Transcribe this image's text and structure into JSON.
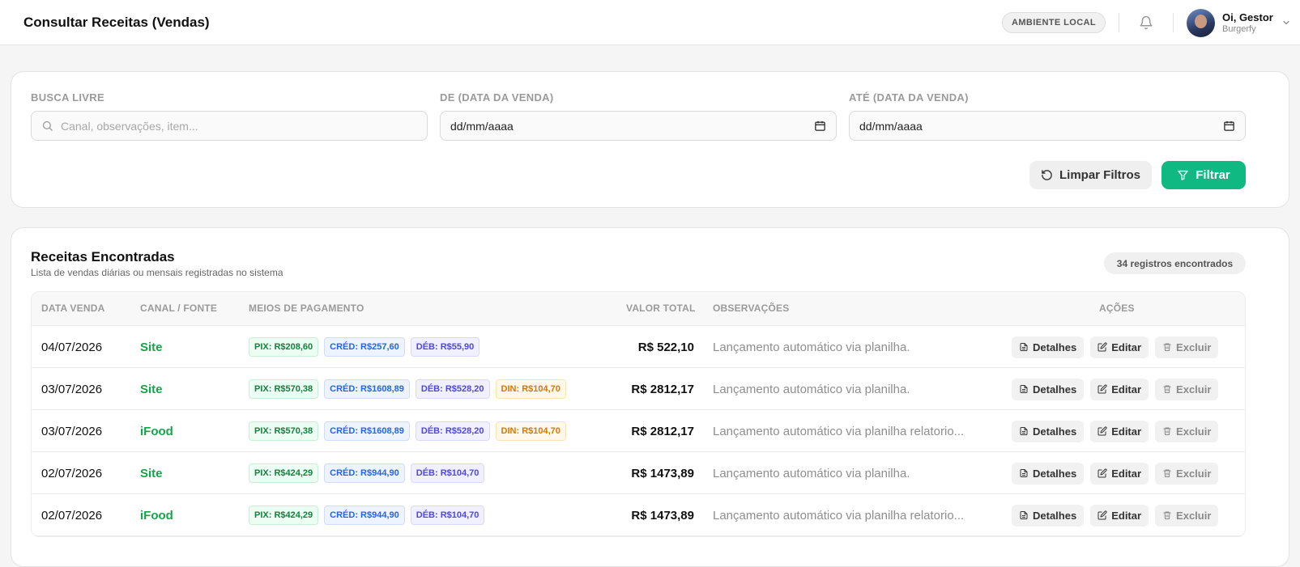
{
  "header": {
    "title": "Consultar Receitas (Vendas)",
    "env_badge": "AMBIENTE LOCAL",
    "user_name": "Oi, Gestor",
    "user_company": "Burgerfy"
  },
  "filters": {
    "search_label": "BUSCA LIVRE",
    "search_placeholder": "Canal, observações, item...",
    "from_label": "DE (DATA DA VENDA)",
    "from_value": "dd/mm/aaaa",
    "to_label": "ATÉ (DATA DA VENDA)",
    "to_value": "dd/mm/aaaa",
    "clear_label": "Limpar Filtros",
    "filter_label": "Filtrar"
  },
  "results": {
    "title": "Receitas Encontradas",
    "subtitle": "Lista de vendas diárias ou mensais registradas no sistema",
    "count": "34 registros encontrados",
    "columns": [
      "DATA VENDA",
      "CANAL / FONTE",
      "MEIOS DE PAGAMENTO",
      "VALOR TOTAL",
      "OBSERVAÇÕES",
      "AÇÕES"
    ],
    "actions": {
      "details": "Detalhes",
      "edit": "Editar",
      "delete": "Excluir"
    },
    "rows": [
      {
        "date": "04/07/2026",
        "channel": "Site",
        "payments": [
          {
            "type": "pix",
            "label": "PIX: R$208,60"
          },
          {
            "type": "cred",
            "label": "CRÉD: R$257,60"
          },
          {
            "type": "deb",
            "label": "DÉB: R$55,90"
          }
        ],
        "total": "R$ 522,10",
        "obs": "Lançamento automático via planilha."
      },
      {
        "date": "03/07/2026",
        "channel": "Site",
        "payments": [
          {
            "type": "pix",
            "label": "PIX: R$570,38"
          },
          {
            "type": "cred",
            "label": "CRÉD: R$1608,89"
          },
          {
            "type": "deb",
            "label": "DÉB: R$528,20"
          },
          {
            "type": "din",
            "label": "DIN: R$104,70"
          }
        ],
        "total": "R$ 2812,17",
        "obs": "Lançamento automático via planilha."
      },
      {
        "date": "03/07/2026",
        "channel": "iFood",
        "payments": [
          {
            "type": "pix",
            "label": "PIX: R$570,38"
          },
          {
            "type": "cred",
            "label": "CRÉD: R$1608,89"
          },
          {
            "type": "deb",
            "label": "DÉB: R$528,20"
          },
          {
            "type": "din",
            "label": "DIN: R$104,70"
          }
        ],
        "total": "R$ 2812,17",
        "obs": "Lançamento automático via planilha relatorio..."
      },
      {
        "date": "02/07/2026",
        "channel": "Site",
        "payments": [
          {
            "type": "pix",
            "label": "PIX: R$424,29"
          },
          {
            "type": "cred",
            "label": "CRÉD: R$944,90"
          },
          {
            "type": "deb",
            "label": "DÉB: R$104,70"
          }
        ],
        "total": "R$ 1473,89",
        "obs": "Lançamento automático via planilha."
      },
      {
        "date": "02/07/2026",
        "channel": "iFood",
        "payments": [
          {
            "type": "pix",
            "label": "PIX: R$424,29"
          },
          {
            "type": "cred",
            "label": "CRÉD: R$944,90"
          },
          {
            "type": "deb",
            "label": "DÉB: R$104,70"
          }
        ],
        "total": "R$ 1473,89",
        "obs": "Lançamento automático via planilha relatorio..."
      }
    ]
  }
}
